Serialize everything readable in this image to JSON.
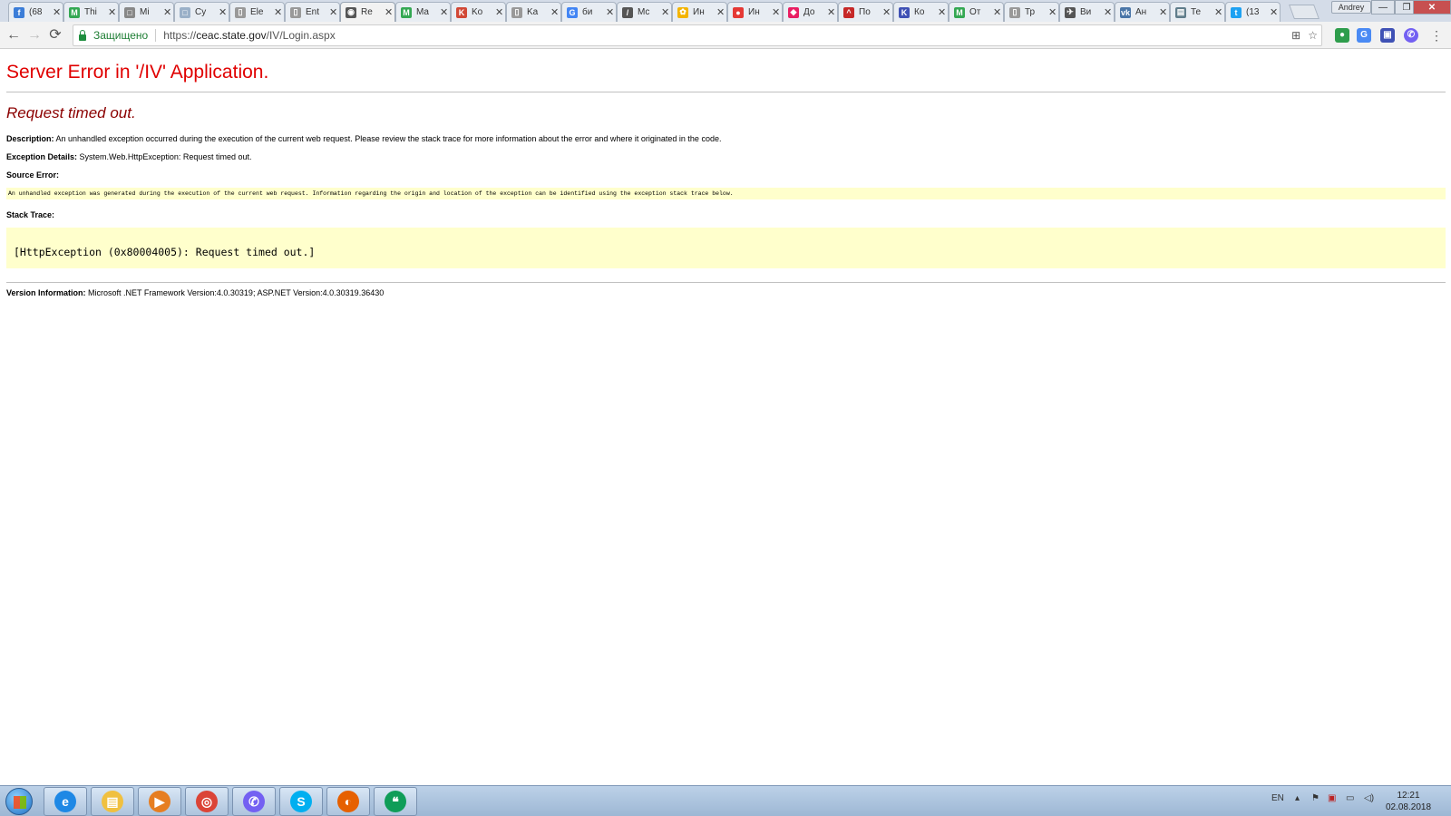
{
  "tabs": [
    {
      "title": "(68",
      "favicon_color": "#3b7dd8",
      "favicon_glyph": "f"
    },
    {
      "title": "Thi",
      "favicon_color": "#34a853",
      "favicon_glyph": "M"
    },
    {
      "title": "Mi",
      "favicon_color": "#888888",
      "favicon_glyph": "□"
    },
    {
      "title": "Cy",
      "favicon_color": "#9ab0c8",
      "favicon_glyph": "□"
    },
    {
      "title": "Ele",
      "favicon_color": "#999999",
      "favicon_glyph": "▯"
    },
    {
      "title": "Ent",
      "favicon_color": "#999999",
      "favicon_glyph": "▯"
    },
    {
      "title": "Re",
      "favicon_color": "#555555",
      "favicon_glyph": "◉",
      "active": true
    },
    {
      "title": "Ma",
      "favicon_color": "#34a853",
      "favicon_glyph": "M"
    },
    {
      "title": "Ko",
      "favicon_color": "#d14836",
      "favicon_glyph": "K"
    },
    {
      "title": "Ka",
      "favicon_color": "#999999",
      "favicon_glyph": "▯"
    },
    {
      "title": "би",
      "favicon_color": "#4285f4",
      "favicon_glyph": "G"
    },
    {
      "title": "Mc",
      "favicon_color": "#555555",
      "favicon_glyph": "/"
    },
    {
      "title": "Ин",
      "favicon_color": "#f4b400",
      "favicon_glyph": "✿"
    },
    {
      "title": "Ин",
      "favicon_color": "#e53935",
      "favicon_glyph": "●"
    },
    {
      "title": "До",
      "favicon_color": "#e91e63",
      "favicon_glyph": "◆"
    },
    {
      "title": "По",
      "favicon_color": "#c62828",
      "favicon_glyph": "^"
    },
    {
      "title": "Ко",
      "favicon_color": "#3f51b5",
      "favicon_glyph": "K"
    },
    {
      "title": "От",
      "favicon_color": "#34a853",
      "favicon_glyph": "M"
    },
    {
      "title": "Тр",
      "favicon_color": "#999999",
      "favicon_glyph": "▯"
    },
    {
      "title": "Ви",
      "favicon_color": "#555555",
      "favicon_glyph": "✈"
    },
    {
      "title": "Ан",
      "favicon_color": "#4a76a8",
      "favicon_glyph": "vk"
    },
    {
      "title": "Те",
      "favicon_color": "#607d8b",
      "favicon_glyph": "▤"
    },
    {
      "title": "(13",
      "favicon_color": "#1da1f2",
      "favicon_glyph": "t"
    }
  ],
  "window": {
    "profile_name": "Andrey",
    "minimize": "—",
    "restore": "❐",
    "close": "✕"
  },
  "toolbar": {
    "back_glyph": "←",
    "forward_glyph": "→",
    "reload_glyph": "⟳",
    "secure_label": "Защищено",
    "url_scheme": "https://",
    "url_host": "ceac.state.gov",
    "url_path": "/IV/Login.aspx",
    "translate_glyph": "⊞",
    "star_glyph": "☆",
    "menu_glyph": "⋮"
  },
  "error_page": {
    "title": "Server Error in '/IV' Application.",
    "subtitle": "Request timed out.",
    "description_label": "Description:",
    "description_text": "An unhandled exception occurred during the execution of the current web request. Please review the stack trace for more information about the error and where it originated in the code.",
    "exception_label": "Exception Details:",
    "exception_text": "System.Web.HttpException: Request timed out.",
    "source_error_label": "Source Error:",
    "source_error_text": "An unhandled exception was generated during the execution of the current web request. Information regarding the origin and location of the exception can be identified using the exception stack trace below.",
    "stack_trace_label": "Stack Trace:",
    "stack_trace_text": "[HttpException (0x80004005): Request timed out.]",
    "version_label": "Version Information:",
    "version_text": "Microsoft .NET Framework Version:4.0.30319; ASP.NET Version:4.0.30319.36430"
  },
  "taskbar": {
    "apps": [
      {
        "name": "internet-explorer",
        "glyph": "e",
        "color": "#1e88e5"
      },
      {
        "name": "file-explorer",
        "glyph": "▤",
        "color": "#f0c040"
      },
      {
        "name": "media-player",
        "glyph": "▶",
        "color": "#e67e22"
      },
      {
        "name": "chrome",
        "glyph": "◎",
        "color": "#db4437"
      },
      {
        "name": "viber",
        "glyph": "✆",
        "color": "#7360f2"
      },
      {
        "name": "skype",
        "glyph": "S",
        "color": "#00aff0"
      },
      {
        "name": "firefox",
        "glyph": "◐",
        "color": "#e66000"
      },
      {
        "name": "hangouts",
        "glyph": "❝",
        "color": "#0f9d58"
      }
    ],
    "language": "EN",
    "time": "12:21",
    "date": "02.08.2018"
  }
}
